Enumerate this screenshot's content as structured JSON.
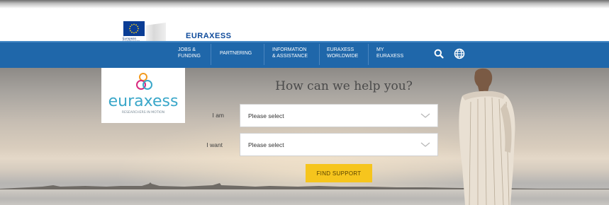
{
  "header": {
    "org_name_lines": [
      "European",
      "Commission"
    ],
    "site_title": "EURAXESS"
  },
  "nav": {
    "items": [
      {
        "line1": "JOBS &",
        "line2": "FUNDING"
      },
      {
        "line1": "PARTNERING",
        "line2": ""
      },
      {
        "line1": "INFORMATION",
        "line2": "& ASSISTANCE"
      },
      {
        "line1": "EURAXESS",
        "line2": "WORLDWIDE"
      },
      {
        "line1": "MY",
        "line2": "EURAXESS"
      }
    ],
    "icons": [
      "search-icon",
      "globe-icon"
    ]
  },
  "hero": {
    "brand_wordmark": "euraxess",
    "brand_tagline": "RESEARCHERS IN MOTION",
    "headline": "How can we help you?",
    "form": {
      "iam_label": "I am",
      "iam_value": "Please select",
      "iwant_label": "I want",
      "iwant_value": "Please select",
      "submit_label": "FIND SUPPORT"
    }
  },
  "colors": {
    "nav_blue": "#1f67aa",
    "title_blue": "#0e4a9a",
    "button_yellow": "#f6c51d",
    "brand_teal": "#3aa7c9",
    "brand_orange": "#f39a1e",
    "brand_pink": "#d8297e"
  }
}
